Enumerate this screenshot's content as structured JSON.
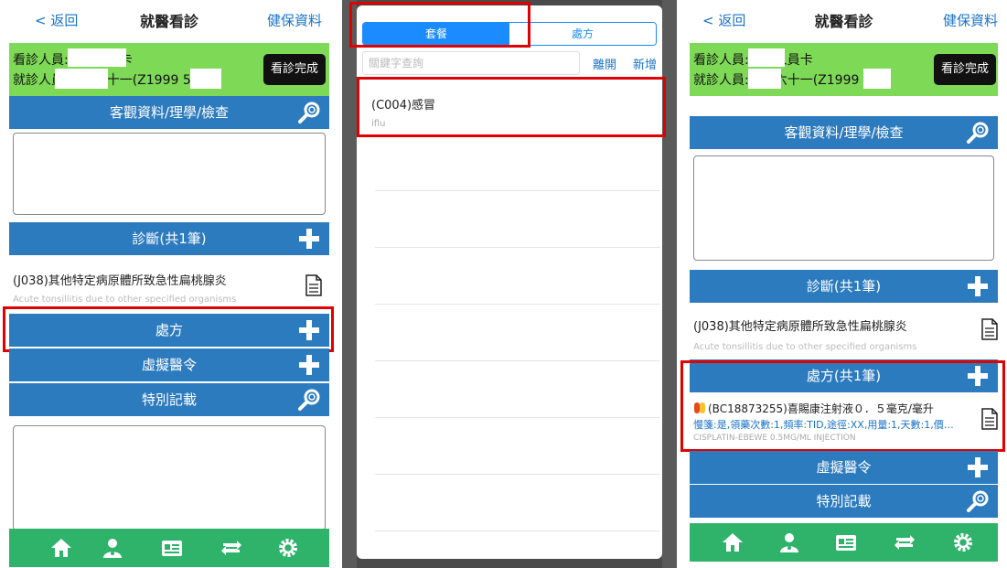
{
  "colors": {
    "accent_blue": "#2d7bbf",
    "info_green": "#7ed957",
    "bottom_green": "#2fb36b",
    "link_blue": "#1a73c8",
    "highlight_red": "#e00000"
  },
  "left": {
    "nav": {
      "back": "< 返回",
      "title": "就醫看診",
      "right": "健保資料"
    },
    "info": {
      "line1": "看診人員:測試人員卡",
      "line2": "就診人員:測試六十一(Z1999  52)"
    },
    "done_button": "看診完成",
    "section_objective": "客觀資料/理學/檢查",
    "section_diagnosis": "診斷(共1筆)",
    "diagnosis_item": "(J038)其他特定病原體所致急性扁桃腺炎",
    "diagnosis_en": "Acute tonsillitis due to other specified organisms",
    "section_prescription": "處方",
    "section_virtual_order": "虛擬醫令",
    "section_special": "特別記載"
  },
  "middle": {
    "tabs": [
      "套餐",
      "處方"
    ],
    "search_placeholder": "關鍵字查詢",
    "leave": "離開",
    "add": "新增",
    "package_title": "(C004)感冒",
    "package_sub": "iflu"
  },
  "right": {
    "nav": {
      "back": "< 返回",
      "title": "就醫看診",
      "right": "健保資料"
    },
    "info": {
      "line1": "看診人員:測試人員卡",
      "line2": "就診人員:測試六十一(Z1999  52)"
    },
    "done_button": "看診完成",
    "section_objective": "客觀資料/理學/檢查",
    "section_diagnosis": "診斷(共1筆)",
    "diagnosis_item": "(J038)其他特定病原體所致急性扁桃腺炎",
    "diagnosis_en": "Acute tonsillitis due to other specified organisms",
    "section_prescription": "處方(共1筆)",
    "rx_item": "(BC18873255)喜賜康注射液０．５毫克/毫升",
    "rx_detail": "慢箋:是,領藥次數:1,頻率:TID,途徑:XX,用量:1,天數:1,價…",
    "rx_en": "CISPLATIN-EBEWE 0.5MG/ML INJECTION",
    "section_virtual_order": "虛擬醫令",
    "section_special": "特別記載"
  },
  "icons": {
    "magnifier": "magnifier-icon",
    "plus": "plus-icon",
    "document": "document-icon",
    "bottom_nav": [
      "home-icon",
      "doctor-icon",
      "card-icon",
      "sync-icon",
      "settings-icon"
    ]
  }
}
